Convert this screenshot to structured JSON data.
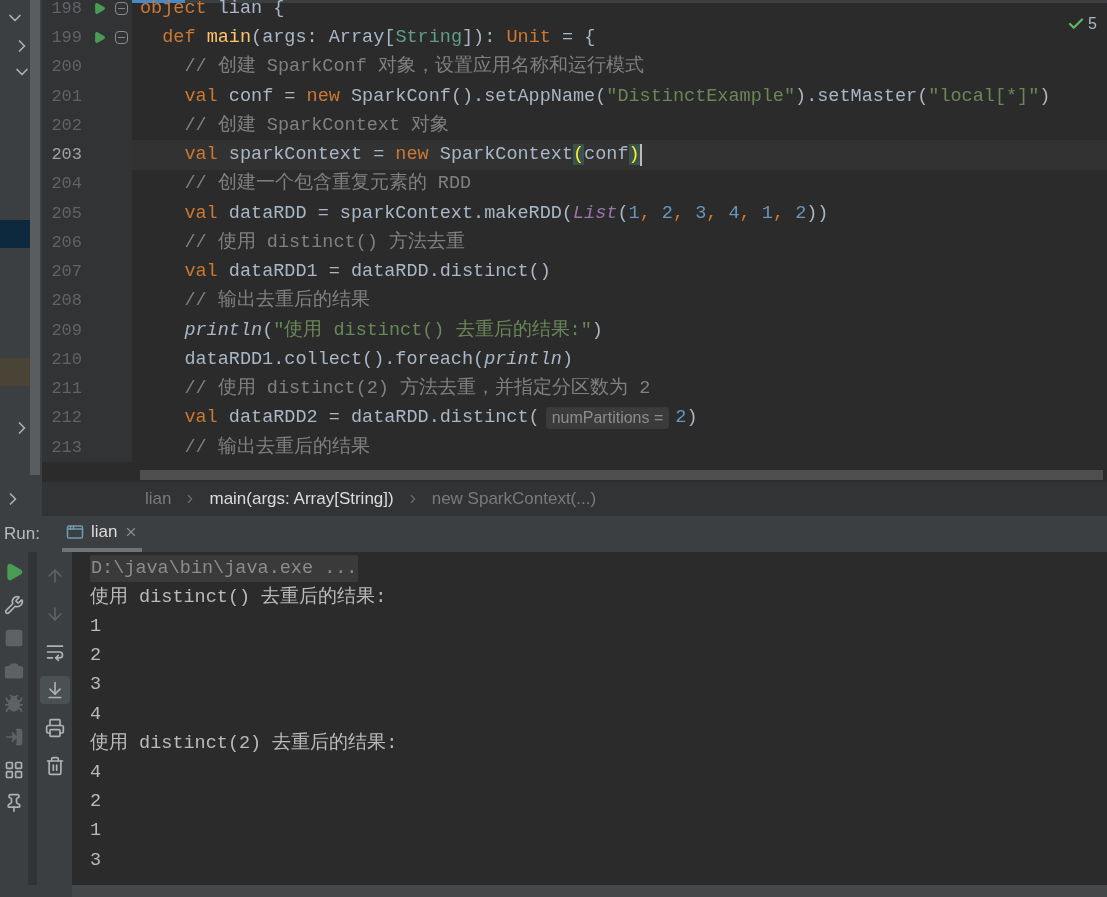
{
  "editor": {
    "inspection_count": "5",
    "lines": [
      {
        "number": "198",
        "run_marker": true,
        "fold_marker": true,
        "current": false,
        "tokens": [
          {
            "kind": "keyword",
            "text": "object"
          },
          {
            "kind": "plain",
            "text": " lian {"
          }
        ]
      },
      {
        "number": "199",
        "run_marker": true,
        "fold_marker": true,
        "current": false,
        "tokens": [
          {
            "kind": "keyword",
            "text": "  def "
          },
          {
            "kind": "function",
            "text": "main"
          },
          {
            "kind": "plain",
            "text": "(args: Array["
          },
          {
            "kind": "type",
            "text": "String"
          },
          {
            "kind": "plain",
            "text": "]): "
          },
          {
            "kind": "keyword",
            "text": "Unit"
          },
          {
            "kind": "plain",
            "text": " = {"
          }
        ]
      },
      {
        "number": "200",
        "run_marker": false,
        "fold_marker": false,
        "current": false,
        "tokens": [
          {
            "kind": "comment",
            "text": "    // 创建 SparkConf 对象，设置应用名称和运行模式"
          }
        ]
      },
      {
        "number": "201",
        "run_marker": false,
        "fold_marker": false,
        "current": false,
        "tokens": [
          {
            "kind": "keyword",
            "text": "    val"
          },
          {
            "kind": "plain",
            "text": " conf = "
          },
          {
            "kind": "keyword",
            "text": "new"
          },
          {
            "kind": "plain",
            "text": " SparkConf().setAppName("
          },
          {
            "kind": "string",
            "text": "\"DistinctExample\""
          },
          {
            "kind": "plain",
            "text": ").setMaster("
          },
          {
            "kind": "string",
            "text": "\"local[*]\""
          },
          {
            "kind": "plain",
            "text": ")"
          }
        ]
      },
      {
        "number": "202",
        "run_marker": false,
        "fold_marker": false,
        "current": false,
        "tokens": [
          {
            "kind": "comment",
            "text": "    // 创建 SparkContext 对象"
          }
        ]
      },
      {
        "number": "203",
        "run_marker": false,
        "fold_marker": false,
        "current": true,
        "tokens": [
          {
            "kind": "keyword",
            "text": "    val"
          },
          {
            "kind": "plain",
            "text": " sparkContext = "
          },
          {
            "kind": "keyword",
            "text": "new"
          },
          {
            "kind": "plain",
            "text": " SparkContext"
          },
          {
            "kind": "brace",
            "text": "("
          },
          {
            "kind": "plain",
            "text": "conf"
          },
          {
            "kind": "brace",
            "text": ")"
          }
        ]
      },
      {
        "number": "204",
        "run_marker": false,
        "fold_marker": false,
        "current": false,
        "tokens": [
          {
            "kind": "comment",
            "text": "    // 创建一个包含重复元素的 RDD"
          }
        ]
      },
      {
        "number": "205",
        "run_marker": false,
        "fold_marker": false,
        "current": false,
        "tokens": [
          {
            "kind": "keyword",
            "text": "    val"
          },
          {
            "kind": "plain",
            "text": " dataRDD = sparkContext.makeRDD("
          },
          {
            "kind": "collection",
            "text": "List"
          },
          {
            "kind": "plain",
            "text": "("
          },
          {
            "kind": "number",
            "text": "1"
          },
          {
            "kind": "keyword",
            "text": ", "
          },
          {
            "kind": "number",
            "text": "2"
          },
          {
            "kind": "keyword",
            "text": ", "
          },
          {
            "kind": "number",
            "text": "3"
          },
          {
            "kind": "keyword",
            "text": ", "
          },
          {
            "kind": "number",
            "text": "4"
          },
          {
            "kind": "keyword",
            "text": ", "
          },
          {
            "kind": "number",
            "text": "1"
          },
          {
            "kind": "keyword",
            "text": ", "
          },
          {
            "kind": "number",
            "text": "2"
          },
          {
            "kind": "plain",
            "text": "))"
          }
        ]
      },
      {
        "number": "206",
        "run_marker": false,
        "fold_marker": false,
        "current": false,
        "tokens": [
          {
            "kind": "comment",
            "text": "    // 使用 distinct() 方法去重"
          }
        ]
      },
      {
        "number": "207",
        "run_marker": false,
        "fold_marker": false,
        "current": false,
        "tokens": [
          {
            "kind": "keyword",
            "text": "    val"
          },
          {
            "kind": "plain",
            "text": " dataRDD1 = dataRDD.distinct()"
          }
        ]
      },
      {
        "number": "208",
        "run_marker": false,
        "fold_marker": false,
        "current": false,
        "tokens": [
          {
            "kind": "comment",
            "text": "    // 输出去重后的结果"
          }
        ]
      },
      {
        "number": "209",
        "run_marker": false,
        "fold_marker": false,
        "current": false,
        "tokens": [
          {
            "kind": "italic",
            "text": "    println"
          },
          {
            "kind": "plain",
            "text": "("
          },
          {
            "kind": "string",
            "text": "\"使用 distinct() 去重后的结果:\""
          },
          {
            "kind": "plain",
            "text": ")"
          }
        ]
      },
      {
        "number": "210",
        "run_marker": false,
        "fold_marker": false,
        "current": false,
        "tokens": [
          {
            "kind": "plain",
            "text": "    dataRDD1.collect().foreach("
          },
          {
            "kind": "italic",
            "text": "println"
          },
          {
            "kind": "plain",
            "text": ")"
          }
        ]
      },
      {
        "number": "211",
        "run_marker": false,
        "fold_marker": false,
        "current": false,
        "tokens": [
          {
            "kind": "comment",
            "text": "    // 使用 distinct(2) 方法去重，并指定分区数为 2"
          }
        ]
      },
      {
        "number": "212",
        "run_marker": false,
        "fold_marker": false,
        "current": false,
        "tokens": [
          {
            "kind": "keyword",
            "text": "    val"
          },
          {
            "kind": "plain",
            "text": " dataRDD2 = dataRDD.distinct("
          },
          {
            "kind": "hint",
            "text": "numPartitions ="
          },
          {
            "kind": "number",
            "text": "2"
          },
          {
            "kind": "plain",
            "text": ")"
          }
        ]
      },
      {
        "number": "213",
        "run_marker": false,
        "fold_marker": false,
        "current": false,
        "tokens": [
          {
            "kind": "comment",
            "text": "    // 输出去重后的结果"
          }
        ]
      }
    ]
  },
  "breadcrumbs": [
    {
      "label": "lian",
      "current": false
    },
    {
      "label": "main(args: Array[String])",
      "current": true
    },
    {
      "label": "new SparkContext(...)",
      "current": false
    }
  ],
  "run_panel": {
    "label": "Run:",
    "tab": {
      "label": "lian",
      "selected": true
    },
    "toolbar_1": [
      {
        "kind": "run",
        "disabled": false
      },
      {
        "kind": "wrench",
        "disabled": false
      },
      {
        "kind": "stop",
        "disabled": true
      },
      {
        "kind": "camera",
        "disabled": true
      },
      {
        "kind": "bug",
        "disabled": true
      },
      {
        "kind": "login",
        "disabled": true
      },
      {
        "kind": "layout",
        "disabled": false
      },
      {
        "kind": "pin",
        "disabled": false
      }
    ],
    "toolbar_2": [
      {
        "kind": "up",
        "disabled": true,
        "on": false
      },
      {
        "kind": "down",
        "disabled": true,
        "on": false
      },
      {
        "kind": "wrap",
        "disabled": false,
        "on": false
      },
      {
        "kind": "scroll_end",
        "disabled": false,
        "on": true
      },
      {
        "kind": "print",
        "disabled": false,
        "on": false
      },
      {
        "kind": "trash",
        "disabled": false,
        "on": false
      }
    ],
    "console": [
      {
        "kind": "command",
        "text": "D:\\java\\bin\\java.exe ..."
      },
      {
        "kind": "output",
        "text": "使用 distinct() 去重后的结果:"
      },
      {
        "kind": "output",
        "text": "1"
      },
      {
        "kind": "output",
        "text": "2"
      },
      {
        "kind": "output",
        "text": "3"
      },
      {
        "kind": "output",
        "text": "4"
      },
      {
        "kind": "output",
        "text": "使用 distinct(2) 去重后的结果:"
      },
      {
        "kind": "output",
        "text": "4"
      },
      {
        "kind": "output",
        "text": "2"
      },
      {
        "kind": "output",
        "text": "1"
      },
      {
        "kind": "output",
        "text": "3"
      }
    ]
  }
}
